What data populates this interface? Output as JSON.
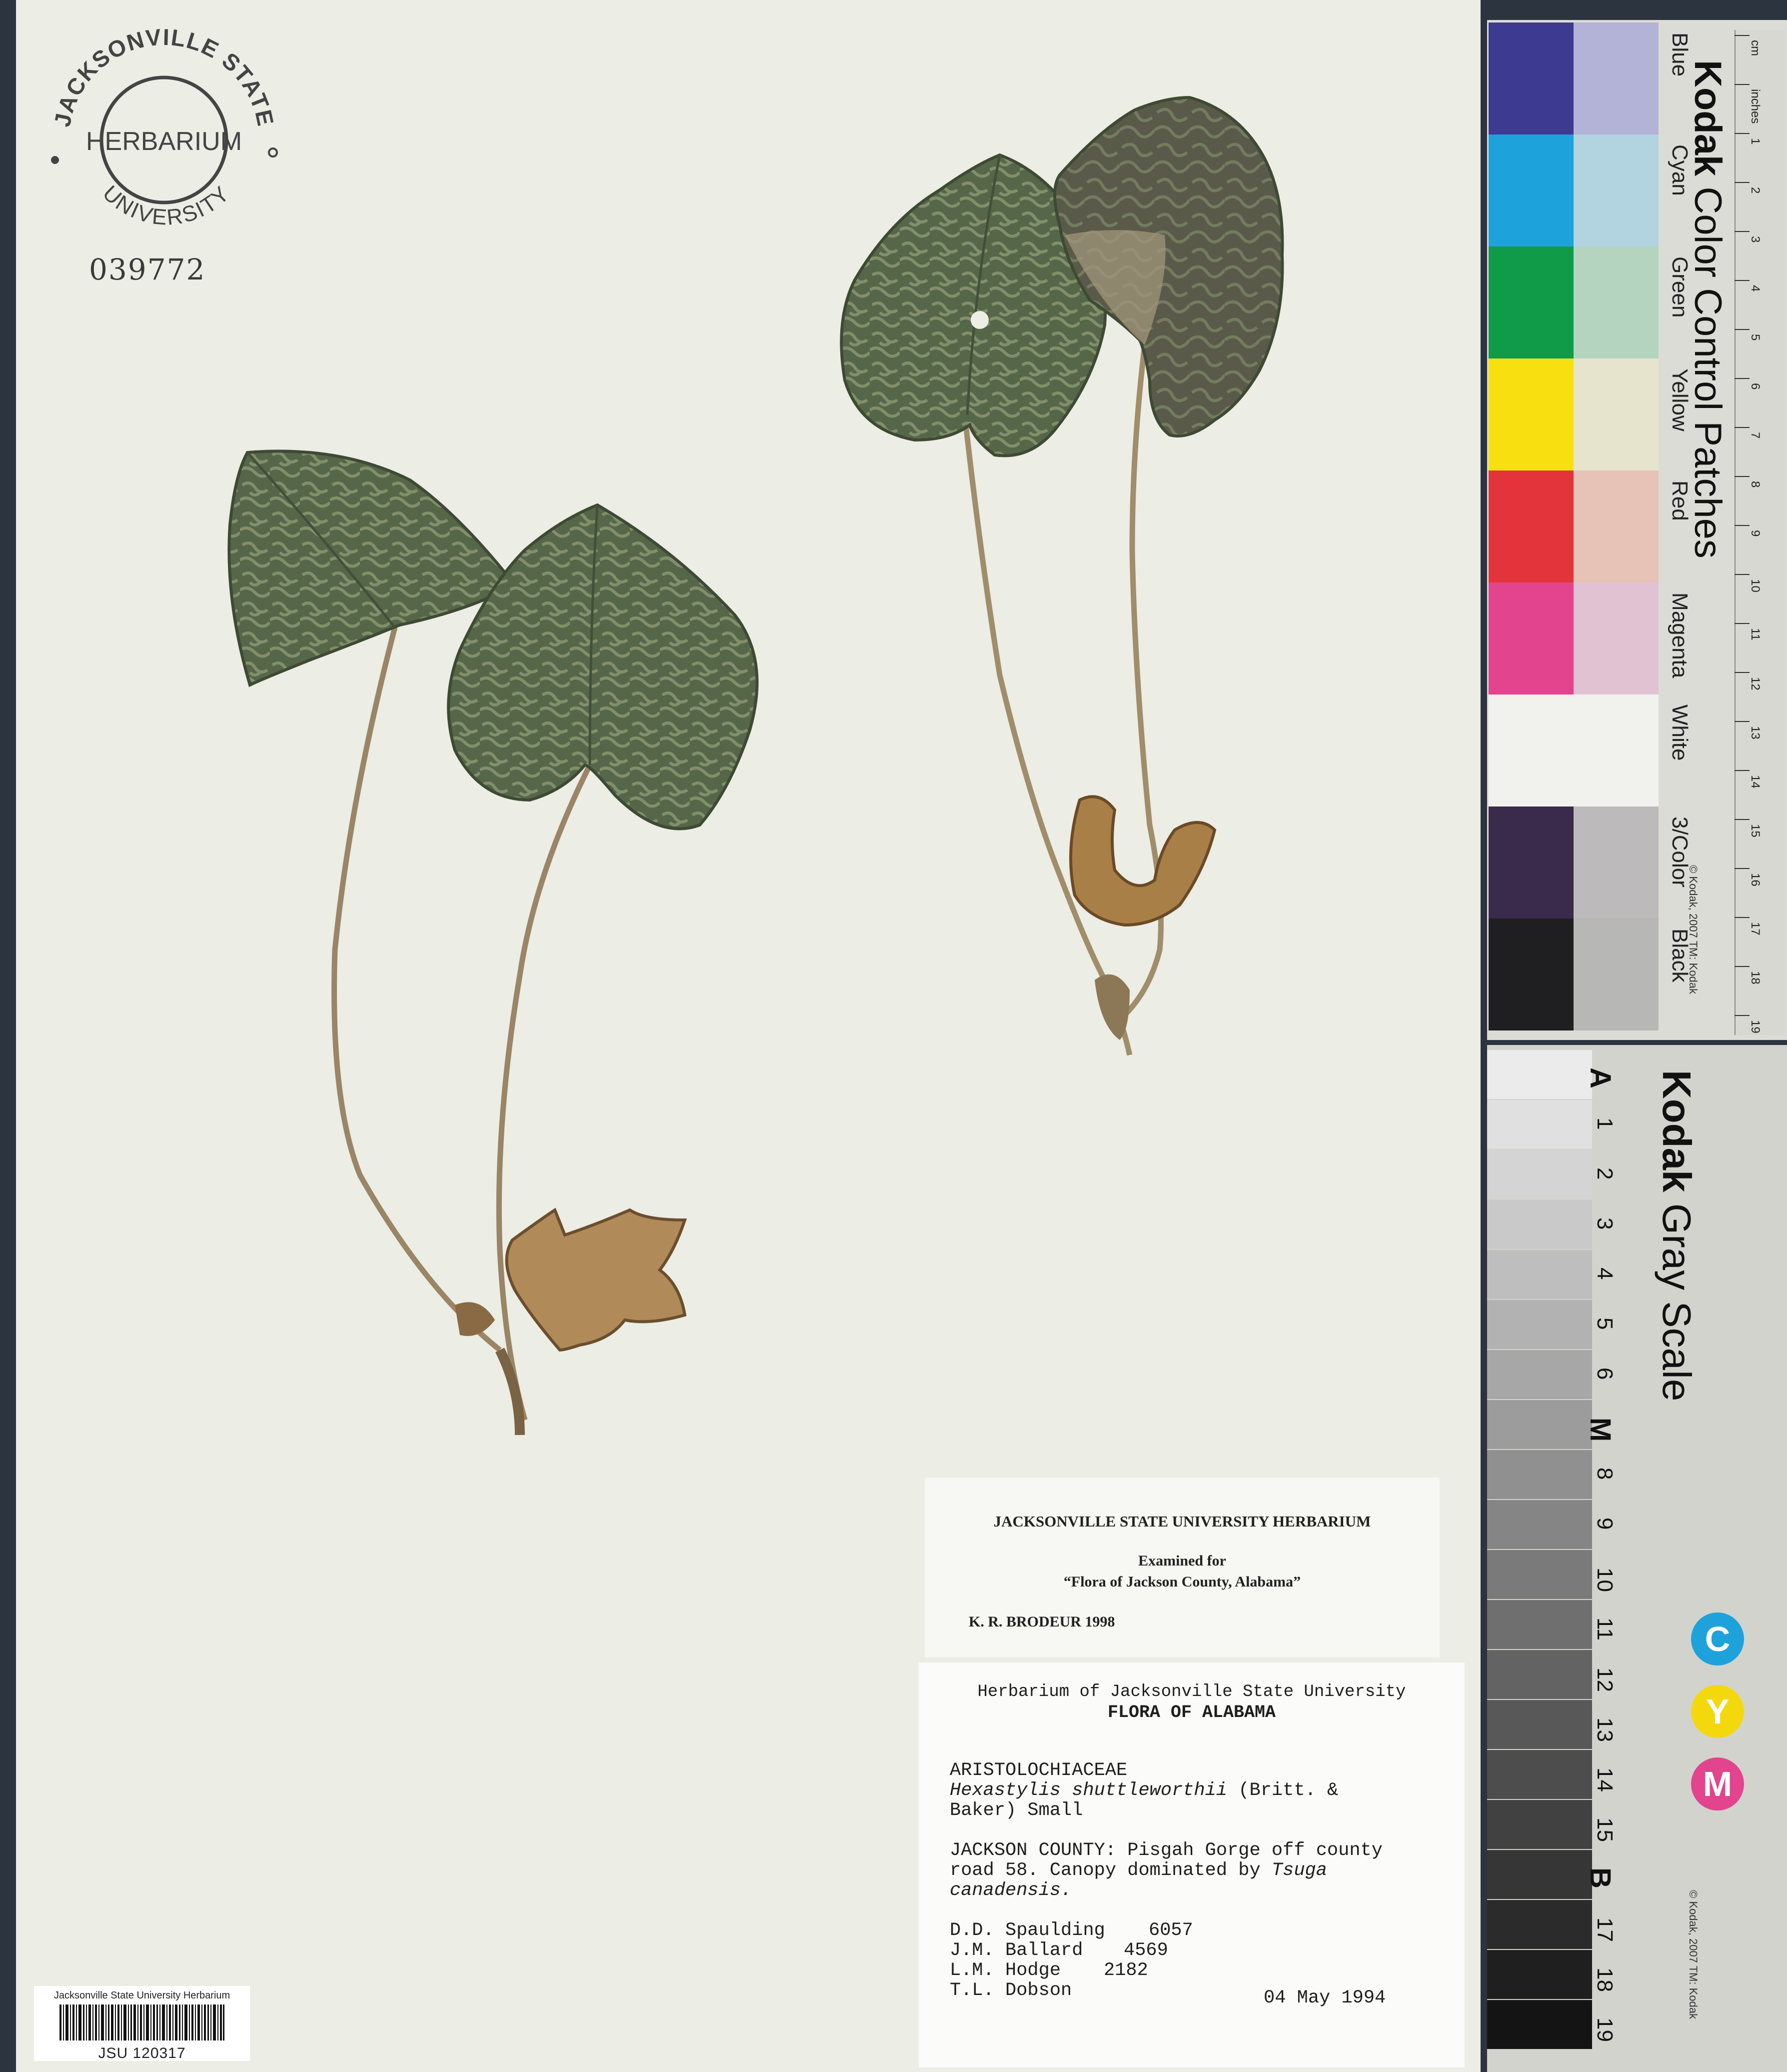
{
  "stamp": {
    "top_text": "JACKSONVILLE STATE",
    "center_text": "HERBARIUM",
    "bottom_text": "UNIVERSITY"
  },
  "catalog_number": "039772",
  "barcode_label": {
    "title": "Jacksonville State University Herbarium",
    "id": "JSU 120317"
  },
  "label_exam": {
    "heading": "JACKSONVILLE STATE UNIVERSITY HERBARIUM",
    "line1": "Examined for",
    "line2": "“Flora of Jackson County, Alabama”",
    "line3": "K. R. BRODEUR 1998"
  },
  "label_main": {
    "header": "Herbarium of Jacksonville State University",
    "subheader": "FLORA OF ALABAMA",
    "family": "ARISTOLOCHIACEAE",
    "species_italic": "Hexastylis shuttleworthii",
    "authority_1": "(Britt. &",
    "authority_2": "Baker) Small",
    "locality_1": "JACKSON COUNTY: Pisgah Gorge off county",
    "locality_2": "road 58. Canopy dominated by",
    "locality_2_italic": "Tsuga",
    "locality_3_italic": "canadensis.",
    "collectors": [
      {
        "name": "D.D. Spaulding",
        "number": "6057"
      },
      {
        "name": "J.M. Ballard",
        "number": "4569"
      },
      {
        "name": "L.M. Hodge",
        "number": "2182"
      },
      {
        "name": "T.L. Dobson",
        "number": ""
      }
    ],
    "date": "04 May 1994"
  },
  "color_card": {
    "brand": "Kodak",
    "title": "Color Control Patches",
    "copyright": "© Kodak, 2007 TM: Kodak",
    "patches": [
      {
        "name": "Blue",
        "dark": "#3d3a91",
        "light": "#b2b3d6"
      },
      {
        "name": "Cyan",
        "dark": "#1ea2dc",
        "light": "#b1d4e0"
      },
      {
        "name": "Green",
        "dark": "#109b48",
        "light": "#b4d4c0"
      },
      {
        "name": "Yellow",
        "dark": "#f8e010",
        "light": "#e6e4cc"
      },
      {
        "name": "Red",
        "dark": "#e3343b",
        "light": "#e6c2b7"
      },
      {
        "name": "Magenta",
        "dark": "#e2448e",
        "light": "#e1c2d3"
      },
      {
        "name": "White",
        "dark": "#f1f1ee",
        "light": "#f1f1ee"
      },
      {
        "name": "3/Color",
        "dark": "#3a2a4c",
        "light": "#bcbabb"
      },
      {
        "name": "Black",
        "dark": "#1f1f21",
        "light": "#b7b7b5"
      }
    ],
    "ruler_labels": [
      "cm",
      "inches",
      "1",
      "2",
      "3",
      "4",
      "5",
      "6",
      "7",
      "8",
      "9",
      "10",
      "11",
      "12",
      "13",
      "14",
      "15",
      "16",
      "17",
      "18",
      "19"
    ]
  },
  "gray_card": {
    "brand": "Kodak",
    "title": "Gray Scale",
    "copyright": "© Kodak, 2007 TM: Kodak",
    "steps": [
      "A",
      "1",
      "2",
      "3",
      "4",
      "5",
      "6",
      "M",
      "8",
      "9",
      "10",
      "11",
      "12",
      "13",
      "14",
      "15",
      "B",
      "17",
      "18",
      "19"
    ],
    "cym": [
      {
        "letter": "C",
        "color": "#1ea2dc"
      },
      {
        "letter": "Y",
        "color": "#f4d80e"
      },
      {
        "letter": "M",
        "color": "#e2448e"
      }
    ]
  }
}
